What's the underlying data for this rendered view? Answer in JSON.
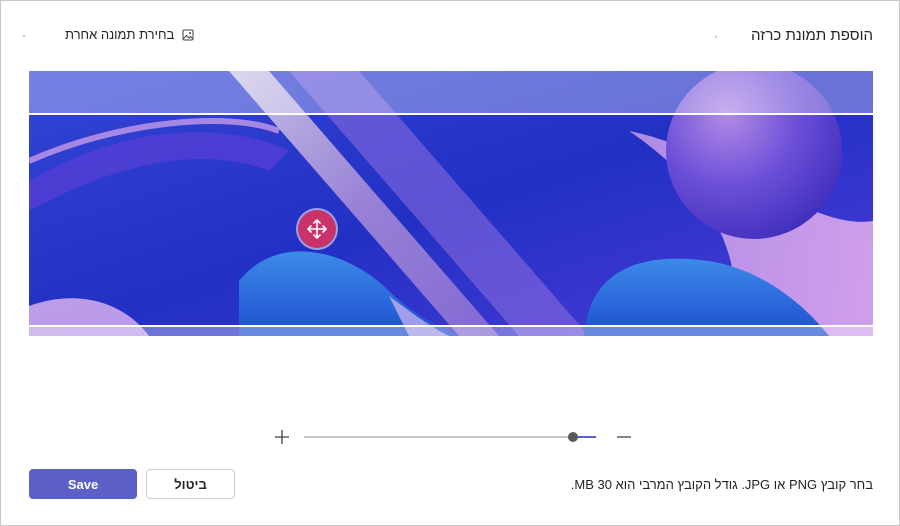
{
  "dialog": {
    "title": "הוספת תמונת כרזה",
    "choose_other_label": "בחירת תמונה אחרת",
    "choose_other_icon": "image-icon",
    "move_handle_icon": "move-arrows-icon",
    "zoom": {
      "plus_icon": "plus-icon",
      "minus_icon": "minus-icon",
      "level": 0.92
    },
    "hint": "בחר קובץ PNG או JPG. גודל הקובץ המרבי הוא 30 MB.",
    "save_label": "Save",
    "cancel_label": "ביטול",
    "colors": {
      "accent": "#5b5fc7",
      "handle": "#c9326a",
      "border": "#c8c8c8"
    }
  }
}
